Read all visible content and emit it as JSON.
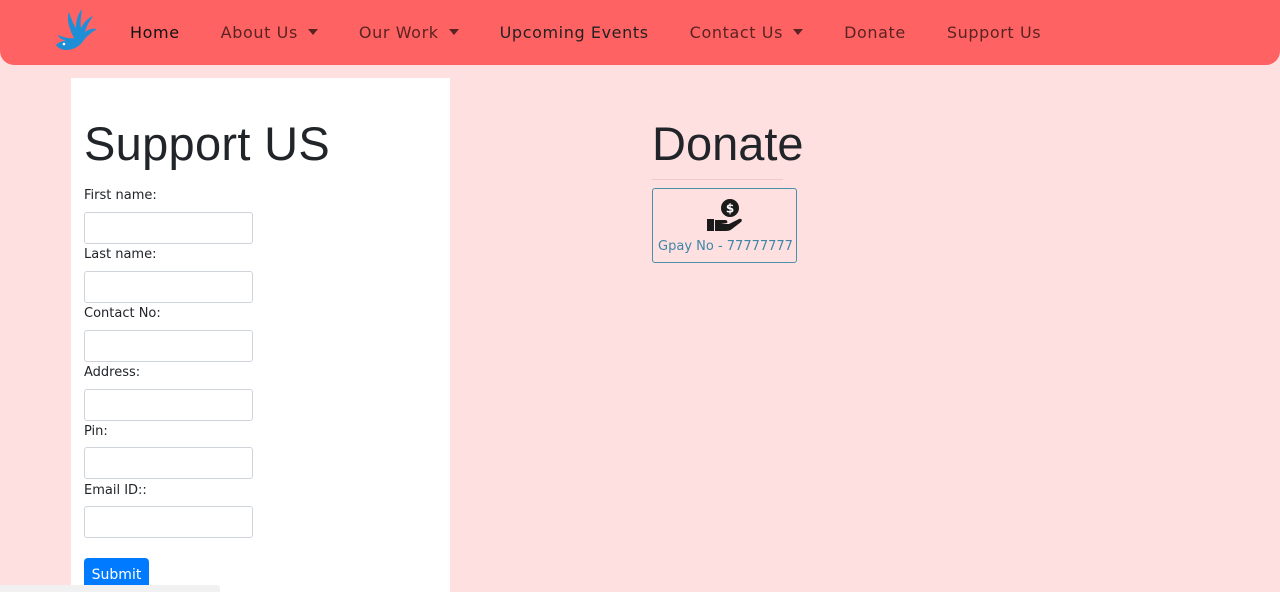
{
  "nav": {
    "items": [
      {
        "label": "Home",
        "dropdown": false
      },
      {
        "label": "About Us",
        "dropdown": true
      },
      {
        "label": "Our Work",
        "dropdown": true
      },
      {
        "label": "Upcoming Events",
        "dropdown": false
      },
      {
        "label": "Contact Us",
        "dropdown": true
      },
      {
        "label": "Donate",
        "dropdown": false
      },
      {
        "label": "Support Us",
        "dropdown": false
      }
    ]
  },
  "support_form": {
    "title": "Support US",
    "fields": [
      {
        "label": "First name:",
        "value": ""
      },
      {
        "label": "Last name:",
        "value": ""
      },
      {
        "label": "Contact No:",
        "value": ""
      },
      {
        "label": "Address:",
        "value": ""
      },
      {
        "label": "Pin:",
        "value": ""
      },
      {
        "label": "Email ID::",
        "value": ""
      }
    ],
    "submit_label": "Submit"
  },
  "donate": {
    "title": "Donate",
    "icon": "hand-holding-dollar-icon",
    "gpay_text": "Gpay No - 77777777"
  },
  "colors": {
    "navbar": "#ff6262",
    "page_background": "#ffe0e0",
    "submit_button": "#007bff",
    "donate_link": "#3d86a8"
  }
}
